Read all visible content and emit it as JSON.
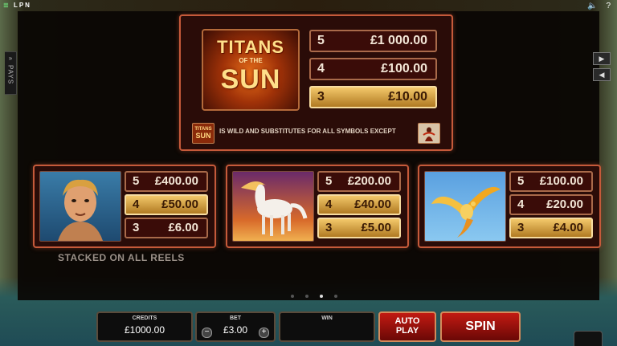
{
  "top": {
    "brand": [
      "≣",
      "L",
      "P",
      "N"
    ],
    "sound_icon": "speaker-icon",
    "help_label": "?"
  },
  "side_tab": {
    "arrows": "»",
    "label": "PAYS"
  },
  "nav": {
    "next": "▶",
    "prev": "◀"
  },
  "main_panel": {
    "logo": {
      "line1": "TITANS",
      "line2": "OF THE",
      "line3": "SUN"
    },
    "pays": [
      {
        "count": "5",
        "value": "£1 000.00"
      },
      {
        "count": "4",
        "value": "£100.00"
      },
      {
        "count": "3",
        "value": "£10.00"
      }
    ],
    "wild_icon": {
      "line1": "TITANS",
      "line2": "SUN"
    },
    "wild_text": "IS WILD AND SUBSTITUTES FOR ALL SYMBOLS EXCEPT"
  },
  "symbols": [
    {
      "icon": "titan-icon",
      "pays": [
        {
          "count": "5",
          "value": "£400.00"
        },
        {
          "count": "4",
          "value": "£50.00"
        },
        {
          "count": "3",
          "value": "£6.00"
        }
      ]
    },
    {
      "icon": "horse-icon",
      "pays": [
        {
          "count": "5",
          "value": "£200.00"
        },
        {
          "count": "4",
          "value": "£40.00"
        },
        {
          "count": "3",
          "value": "£5.00"
        }
      ]
    },
    {
      "icon": "phoenix-icon",
      "pays": [
        {
          "count": "5",
          "value": "£100.00"
        },
        {
          "count": "4",
          "value": "£20.00"
        },
        {
          "count": "3",
          "value": "£4.00"
        }
      ]
    }
  ],
  "stacked_text": "STACKED ON ALL REELS",
  "pager": {
    "count": 4,
    "active_page": 3
  },
  "bottom": {
    "credits_label": "CREDITS",
    "credits_value": "£1000.00",
    "bet_label": "BET",
    "bet_value": "£3.00",
    "bet_minus": "−",
    "bet_plus": "+",
    "win_label": "WIN",
    "autoplay_line1": "AUTO",
    "autoplay_line2": "PLAY",
    "spin_label": "SPIN"
  }
}
